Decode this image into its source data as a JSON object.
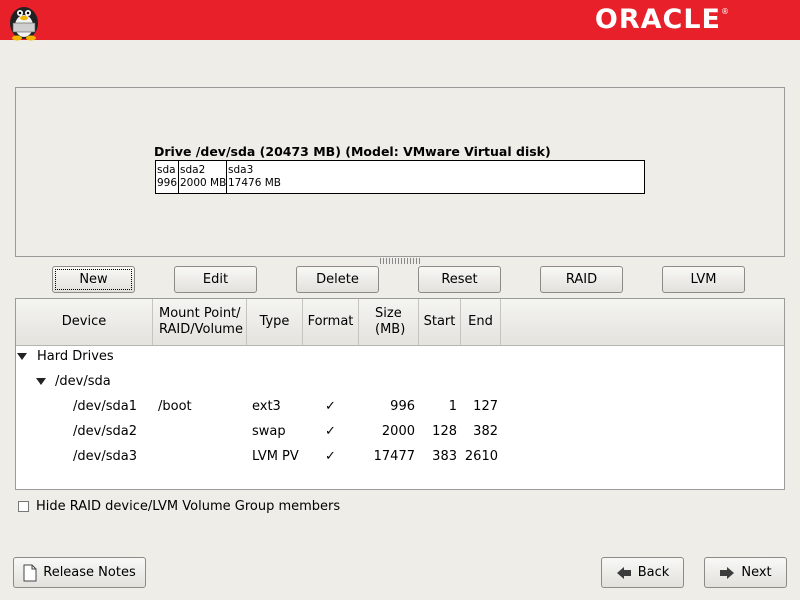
{
  "header": {
    "brand": "ORACLE"
  },
  "drive": {
    "title": "Drive /dev/sda (20473 MB) (Model: VMware Virtual disk)",
    "partitions": [
      {
        "name": "sda",
        "size": "996"
      },
      {
        "name": "sda2",
        "size": "2000 MB"
      },
      {
        "name": "sda3",
        "size": "17476 MB"
      }
    ]
  },
  "buttons": {
    "new": "New",
    "edit": "Edit",
    "delete": "Delete",
    "reset": "Reset",
    "raid": "RAID",
    "lvm": "LVM"
  },
  "table": {
    "columns": [
      "Device",
      "Mount Point/\nRAID/Volume",
      "Type",
      "Format",
      "Size\n(MB)",
      "Start",
      "End"
    ],
    "groups": [
      {
        "label": "Hard Drives"
      },
      {
        "label": "/dev/sda"
      }
    ],
    "rows": [
      {
        "device": "/dev/sda1",
        "mount": "/boot",
        "type": "ext3",
        "format": "✓",
        "size": "996",
        "start": "1",
        "end": "127"
      },
      {
        "device": "/dev/sda2",
        "mount": "",
        "type": "swap",
        "format": "✓",
        "size": "2000",
        "start": "128",
        "end": "382"
      },
      {
        "device": "/dev/sda3",
        "mount": "",
        "type": "LVM PV",
        "format": "✓",
        "size": "17477",
        "start": "383",
        "end": "2610"
      }
    ]
  },
  "options": {
    "hide_members": "Hide RAID device/LVM Volume Group members",
    "hide_members_checked": false
  },
  "footer": {
    "release_notes": "Release Notes",
    "back": "Back",
    "next": "Next"
  },
  "colors": {
    "header_bg": "#e8202a",
    "window_bg": "#eeede8"
  }
}
